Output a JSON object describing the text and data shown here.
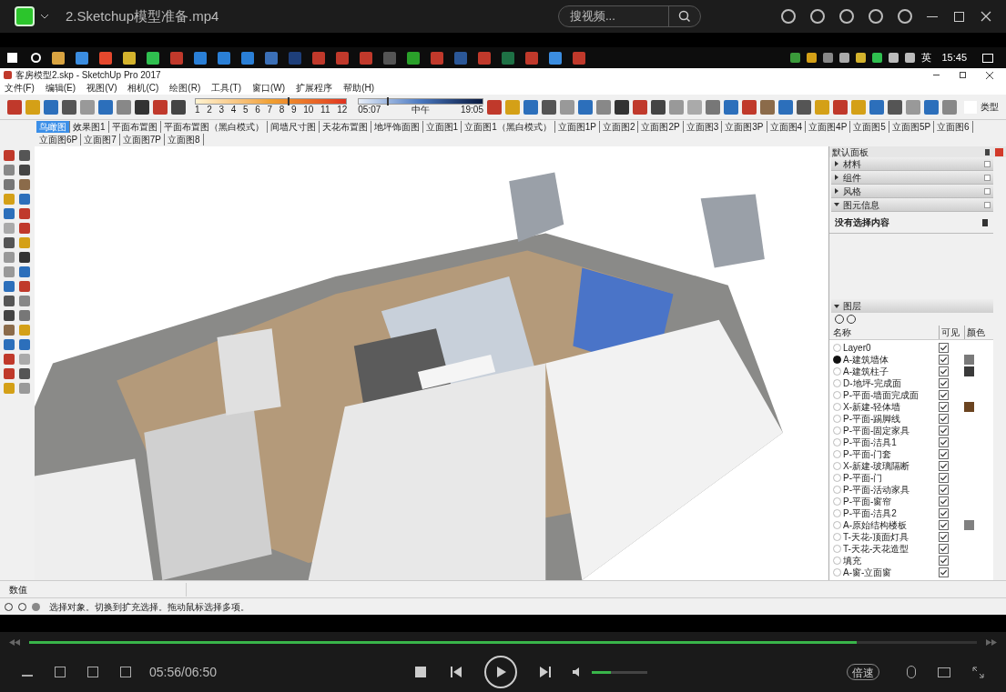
{
  "player": {
    "title": "2.Sketchup模型准备.mp4",
    "search": {
      "placeholder": "搜视频..."
    },
    "time": "05:56/06:50",
    "progress": {
      "level": 0.873
    },
    "volume": {
      "level": 0.34
    },
    "speed_button": "倍速"
  },
  "taskbar": {
    "ime": "英",
    "clock": "15:45"
  },
  "sketchup": {
    "title": "客房模型2.skp - SketchUp Pro 2017",
    "menu": [
      "文件(F)",
      "编辑(E)",
      "视图(V)",
      "相机(C)",
      "绘图(R)",
      "工具(T)",
      "窗口(W)",
      "扩展程序",
      "帮助(H)"
    ],
    "shadow_months": [
      "1",
      "2",
      "3",
      "4",
      "5",
      "6",
      "7",
      "8",
      "9",
      "10",
      "11",
      "12"
    ],
    "shadow_month_slider": {
      "level": 0.61
    },
    "shadow_times": [
      "05:07",
      "中午",
      "19:05"
    ],
    "shadow_time_slider": {
      "level": 0.23
    },
    "toolbar_label": "类型",
    "scenes": [
      {
        "label": "鸟瞰图",
        "selected": true
      },
      {
        "label": "效果图1",
        "selected": false
      },
      {
        "label": "平面布置图",
        "selected": false
      },
      {
        "label": "平面布置图（黑白模式）",
        "selected": false
      },
      {
        "label": "间墙尺寸图",
        "selected": false
      },
      {
        "label": "天花布置图",
        "selected": false
      },
      {
        "label": "地坪饰面图",
        "selected": false
      },
      {
        "label": "立面图1",
        "selected": false
      },
      {
        "label": "立面图1（黑白模式）",
        "selected": false
      },
      {
        "label": "立面图1P",
        "selected": false
      },
      {
        "label": "立面图2",
        "selected": false
      },
      {
        "label": "立面图2P",
        "selected": false
      },
      {
        "label": "立面图3",
        "selected": false
      },
      {
        "label": "立面图3P",
        "selected": false
      },
      {
        "label": "立面图4",
        "selected": false
      },
      {
        "label": "立面图4P",
        "selected": false
      },
      {
        "label": "立面图5",
        "selected": false
      },
      {
        "label": "立面图5P",
        "selected": false
      },
      {
        "label": "立面图6",
        "selected": false
      },
      {
        "label": "立面图6P",
        "selected": false
      },
      {
        "label": "立面图7",
        "selected": false
      },
      {
        "label": "立面图7P",
        "selected": false
      },
      {
        "label": "立面图8",
        "selected": false
      }
    ],
    "tray": {
      "title": "默认面板",
      "sections": [
        {
          "label": "材料",
          "expanded": false
        },
        {
          "label": "组件",
          "expanded": false
        },
        {
          "label": "风格",
          "expanded": false
        },
        {
          "label": "图元信息",
          "expanded": true
        }
      ],
      "entity_info": "没有选择内容",
      "layers_section": {
        "label": "图层",
        "expanded": true
      },
      "layer_columns": [
        "名称",
        "可见",
        "颜色"
      ],
      "layers": [
        {
          "name": "Layer0",
          "selected": false,
          "visible": true
        },
        {
          "name": "A-建筑墙体",
          "selected": true,
          "visible": true,
          "color": "#7a7a7a"
        },
        {
          "name": "A-建筑柱子",
          "selected": false,
          "visible": true,
          "color": "#3a3a3a"
        },
        {
          "name": "D-地坪-完成面",
          "selected": false,
          "visible": true
        },
        {
          "name": "P-平面-墙面完成面",
          "selected": false,
          "visible": true
        },
        {
          "name": "X-新建-轻体墙",
          "selected": false,
          "visible": true,
          "color": "#6b4420"
        },
        {
          "name": "P-平面-踢脚线",
          "selected": false,
          "visible": true
        },
        {
          "name": "P-平面-固定家具",
          "selected": false,
          "visible": true
        },
        {
          "name": "P-平面-洁具1",
          "selected": false,
          "visible": true
        },
        {
          "name": "P-平面-门套",
          "selected": false,
          "visible": true
        },
        {
          "name": "X-新建-玻璃隔断",
          "selected": false,
          "visible": true
        },
        {
          "name": "P-平面-门",
          "selected": false,
          "visible": true
        },
        {
          "name": "P-平面-活动家具",
          "selected": false,
          "visible": true
        },
        {
          "name": "P-平面-窗帘",
          "selected": false,
          "visible": true
        },
        {
          "name": "P-平面-洁具2",
          "selected": false,
          "visible": true
        },
        {
          "name": "A-原始结构楼板",
          "selected": false,
          "visible": true,
          "color": "#808080"
        },
        {
          "name": "T-天花-顶面灯具",
          "selected": false,
          "visible": true
        },
        {
          "name": "T-天花-天花造型",
          "selected": false,
          "visible": true
        },
        {
          "name": "填充",
          "selected": false,
          "visible": true
        },
        {
          "name": "A-窗-立面窗",
          "selected": false,
          "visible": true
        }
      ]
    },
    "measurements_label": "数值",
    "status": "选择对象。切换到扩充选择。拖动鼠标选择多项。"
  }
}
